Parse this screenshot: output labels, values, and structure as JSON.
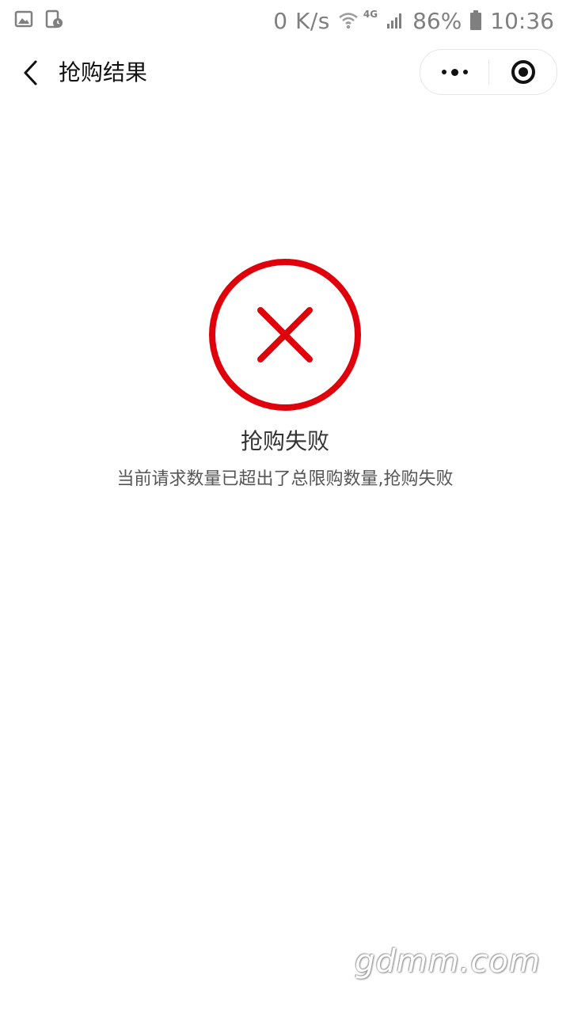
{
  "status_bar": {
    "speed": "0 K/s",
    "network": "4G",
    "battery": "86%",
    "time": "10:36",
    "icons": [
      "image-icon",
      "screen-timer-icon",
      "wifi-icon",
      "signal-icon",
      "battery-icon"
    ]
  },
  "nav": {
    "title": "抢购结果",
    "back_icon": "chevron-left-icon",
    "more_icon": "more-dots-icon",
    "close_icon": "target-close-icon"
  },
  "result": {
    "icon": "error-x-circle-icon",
    "color": "#e0000b",
    "title": "抢购失败",
    "message": "当前请求数量已超出了总限购数量,抢购失败"
  },
  "watermark": "gdmm.com"
}
